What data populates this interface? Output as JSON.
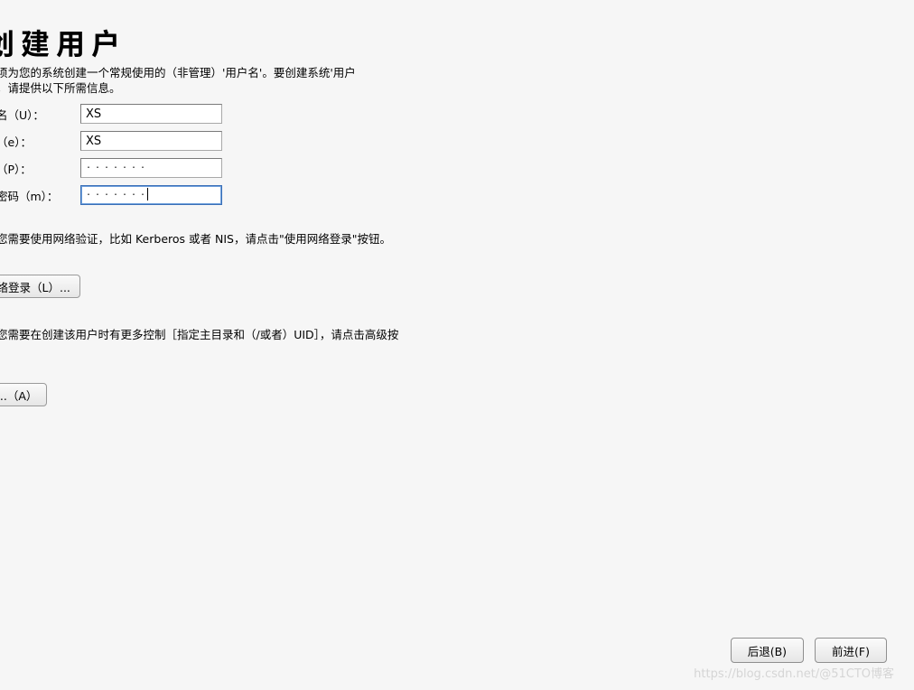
{
  "title": "创建用户",
  "intro_line1": "须为您的系统创建一个常规使用的（非管理）'用户名'。要创建系统'用户",
  "intro_line2": "，请提供以下所需信息。",
  "fields": {
    "username": {
      "label": "名（U）：",
      "value": "XS"
    },
    "fullname": {
      "label": "（e）：",
      "value": "XS"
    },
    "password": {
      "label": "（P）：",
      "value": "·······"
    },
    "confirm": {
      "label": "密码（m）：",
      "value": "·······"
    }
  },
  "note1": "您需要使用网络验证，比如 Kerberos 或者 NIS，请点击\"使用网络登录\"按钮。",
  "note2": "您需要在创建该用户时有更多控制［指定主目录和（/或者）UID］，请点击高级按",
  "buttons": {
    "network_login": "网络登录（L）...",
    "advanced": "......（A）",
    "back": "后退(B)",
    "forward": "前进(F)"
  },
  "watermark": "https://blog.csdn.net/@51CTO博客"
}
